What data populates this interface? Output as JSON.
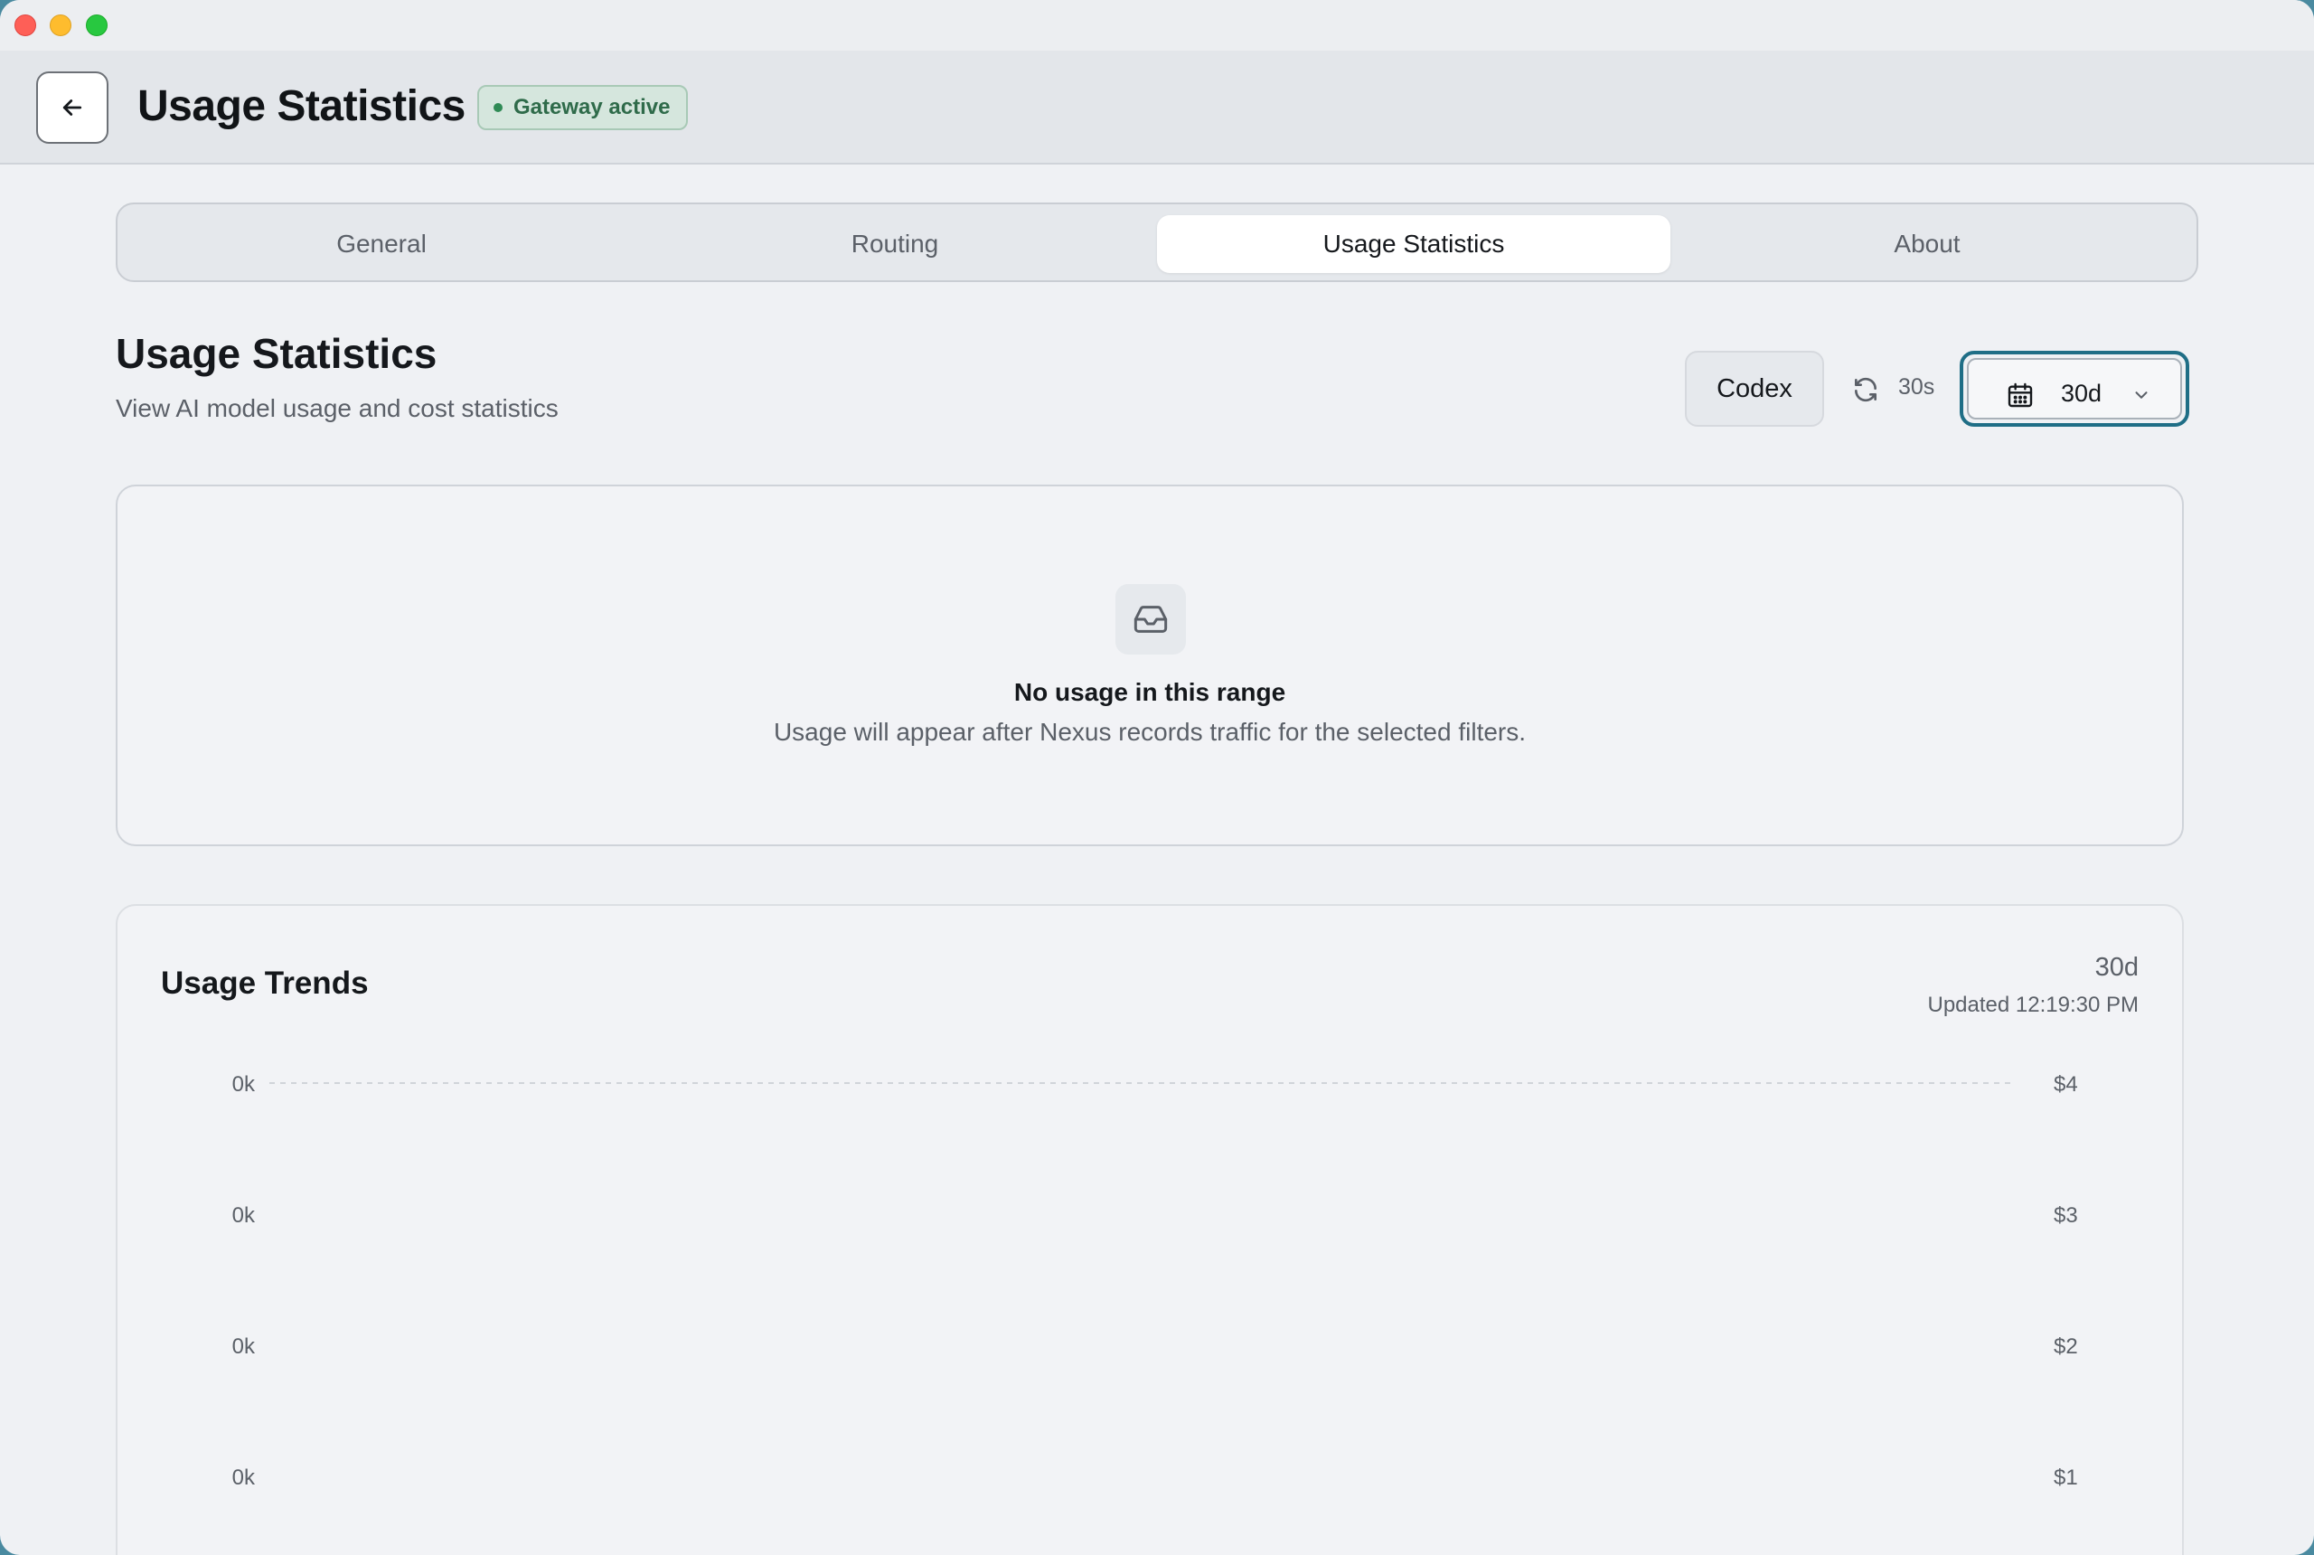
{
  "header": {
    "title": "Usage Statistics",
    "status_badge": "Gateway active"
  },
  "tabs": [
    {
      "label": "General",
      "active": false
    },
    {
      "label": "Routing",
      "active": false
    },
    {
      "label": "Usage Statistics",
      "active": true
    },
    {
      "label": "About",
      "active": false
    }
  ],
  "page": {
    "title": "Usage Statistics",
    "subtitle": "View AI model usage and cost statistics"
  },
  "controls": {
    "provider_filter": "Codex",
    "refresh_interval": "30s",
    "range_selected": "30d"
  },
  "empty_state": {
    "title": "No usage in this range",
    "description": "Usage will appear after Nexus records traffic for the selected filters."
  },
  "trends": {
    "title": "Usage Trends",
    "range": "30d",
    "updated": "Updated 12:19:30 PM"
  },
  "icons": [
    "arrow-left-icon",
    "refresh-icon",
    "calendar-icon",
    "chevron-down-icon",
    "inbox-icon"
  ],
  "colors": {
    "accent": "#1f6e86",
    "status_green": "#2f6b4a",
    "background": "#eff1f4"
  },
  "chart_data": {
    "type": "line",
    "title": "Usage Trends",
    "y_left_ticks": [
      "0k",
      "0k",
      "0k",
      "0k"
    ],
    "y_right_ticks": [
      "$4",
      "$3",
      "$2",
      "$1"
    ],
    "series": [],
    "grid": "dashed top line"
  }
}
